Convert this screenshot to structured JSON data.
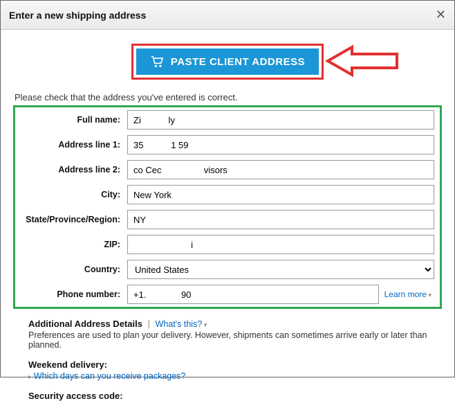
{
  "header": {
    "title": "Enter a new shipping address"
  },
  "paste_button": {
    "label": "PASTE CLIENT ADDRESS"
  },
  "instruction": "Please check that the address you've entered is correct.",
  "labels": {
    "full_name": "Full name:",
    "address1": "Address line 1:",
    "address2": "Address line 2:",
    "city": "City:",
    "state": "State/Province/Region:",
    "zip": "ZIP:",
    "country": "Country:",
    "phone": "Phone number:"
  },
  "values": {
    "full_name": "Zi           ly",
    "address1": "35           1 59",
    "address2": "co Cec                 visors",
    "city": "New York",
    "state": "NY",
    "zip": "                       i",
    "country": "United States",
    "phone": "+1.              90"
  },
  "learn_more": "Learn more",
  "additional": {
    "title": "Additional Address Details",
    "whats_this": "What's this?",
    "pref_text": "Preferences are used to plan your delivery. However, shipments can sometimes arrive early or later than planned."
  },
  "weekend": {
    "title": "Weekend delivery:",
    "link": "Which days can you receive packages?"
  },
  "security": {
    "title": "Security access code:"
  }
}
